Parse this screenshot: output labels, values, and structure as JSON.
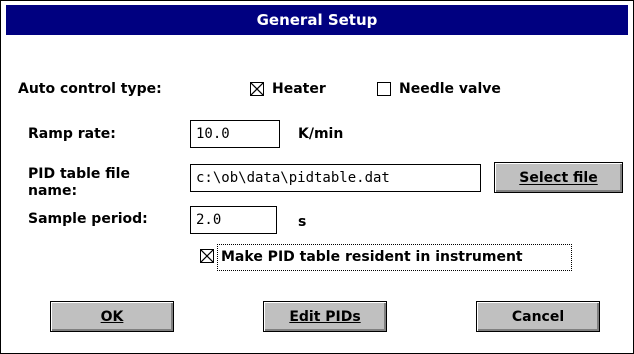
{
  "window": {
    "title": "General Setup"
  },
  "auto_control": {
    "label": "Auto control type:",
    "heater": {
      "label": "Heater",
      "checked": true
    },
    "needle_valve": {
      "label": "Needle valve",
      "checked": false
    }
  },
  "ramp_rate": {
    "label": "Ramp rate:",
    "value": "10.0",
    "unit": "K/min"
  },
  "pid_file": {
    "label_line1": "PID table file",
    "label_line2": "name:",
    "value": "c:\\ob\\data\\pidtable.dat",
    "select_button": "Select file"
  },
  "sample_period": {
    "label": "Sample period:",
    "value": "2.0",
    "unit": "s"
  },
  "resident": {
    "label": "Make PID table resident in instrument",
    "checked": true
  },
  "buttons": {
    "ok": "OK",
    "edit_pids": "Edit PIDs",
    "cancel": "Cancel"
  }
}
